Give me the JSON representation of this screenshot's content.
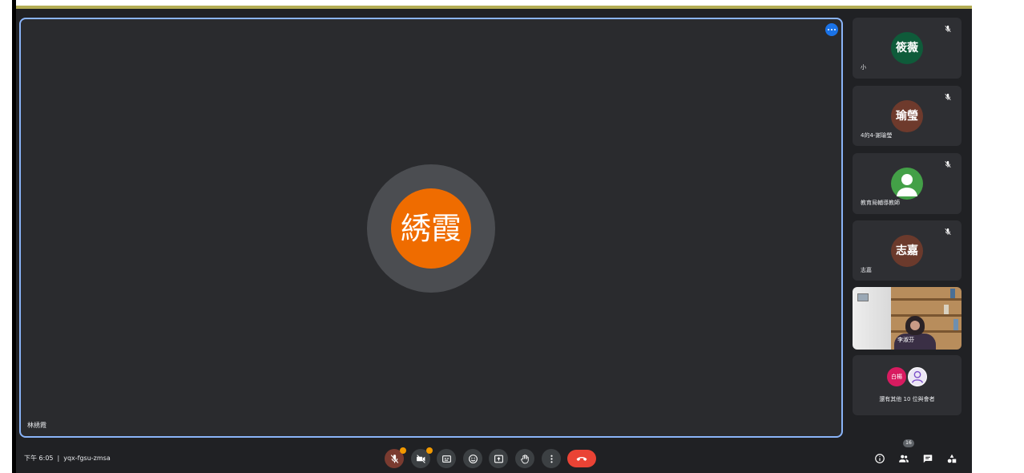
{
  "main_tile": {
    "avatar_initials": "綉霞",
    "avatar_color": "#ef6c00",
    "name": "林綉霞",
    "speaking_indicator": "audio-level-icon"
  },
  "participants": [
    {
      "initials": "筱薇",
      "name": "小",
      "avatar_color": "#0f5b3a",
      "mic_icon": "mic-off-icon"
    },
    {
      "initials": "瑜瑩",
      "name": "4的4-謝瑜瑩",
      "avatar_color": "#6e3a2c",
      "mic_icon": "mic-off-icon"
    },
    {
      "name": "教育局輔導教師",
      "avatar_color": "#43a047",
      "avatar_icon": "default-person-icon",
      "mic_icon": "mic-off-icon"
    },
    {
      "initials": "志嘉",
      "name": "志嘉",
      "avatar_color": "#6b3a2c",
      "mic_icon": "mic-off-icon"
    },
    {
      "name": "李淑芬",
      "video_icon": "camera-feed"
    }
  ],
  "others": {
    "avatar_initials": "白楊",
    "avatar_color": "#d81b60",
    "second_avatar_color": "#ece7f5",
    "label": "還有其他 10 位與會者"
  },
  "meeting_info": {
    "time": "下午 6:05",
    "separator": "|",
    "code": "yqx-fgsu-zmsa"
  },
  "controls": [
    "mic-off-icon",
    "camera-off-icon",
    "captions-icon",
    "emoji-icon",
    "present-icon",
    "raise-hand-icon",
    "more-options-icon",
    "end-call-icon"
  ],
  "side_controls": [
    "info-icon",
    "people-icon",
    "chat-icon",
    "activities-icon"
  ],
  "people_count": "16",
  "colors": {
    "background": "#202124",
    "tile": "#2e2f33",
    "active_speaker_border": "#8ab4f8",
    "end_call": "#ea4335",
    "notification_badge": "#f29900",
    "accent_bar": "#b3ad55"
  }
}
